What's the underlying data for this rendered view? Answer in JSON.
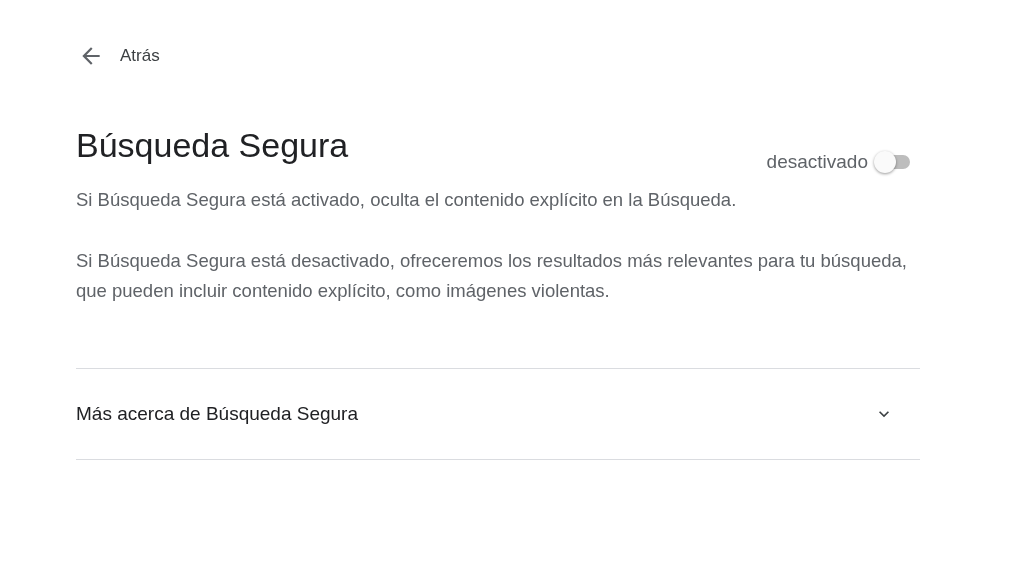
{
  "back": {
    "label": "Atrás"
  },
  "title": "Búsqueda Segura",
  "toggle": {
    "label": "desactivado",
    "on": false
  },
  "paragraphs": [
    "Si Búsqueda Segura está activado, oculta el contenido explícito en la Búsqueda.",
    "Si Búsqueda Segura está desactivado, ofreceremos los resultados más relevantes para tu búsqueda, que pueden incluir contenido explícito, como imágenes violentas."
  ],
  "expander": {
    "label": "Más acerca de Búsqueda Segura",
    "expanded": false
  }
}
